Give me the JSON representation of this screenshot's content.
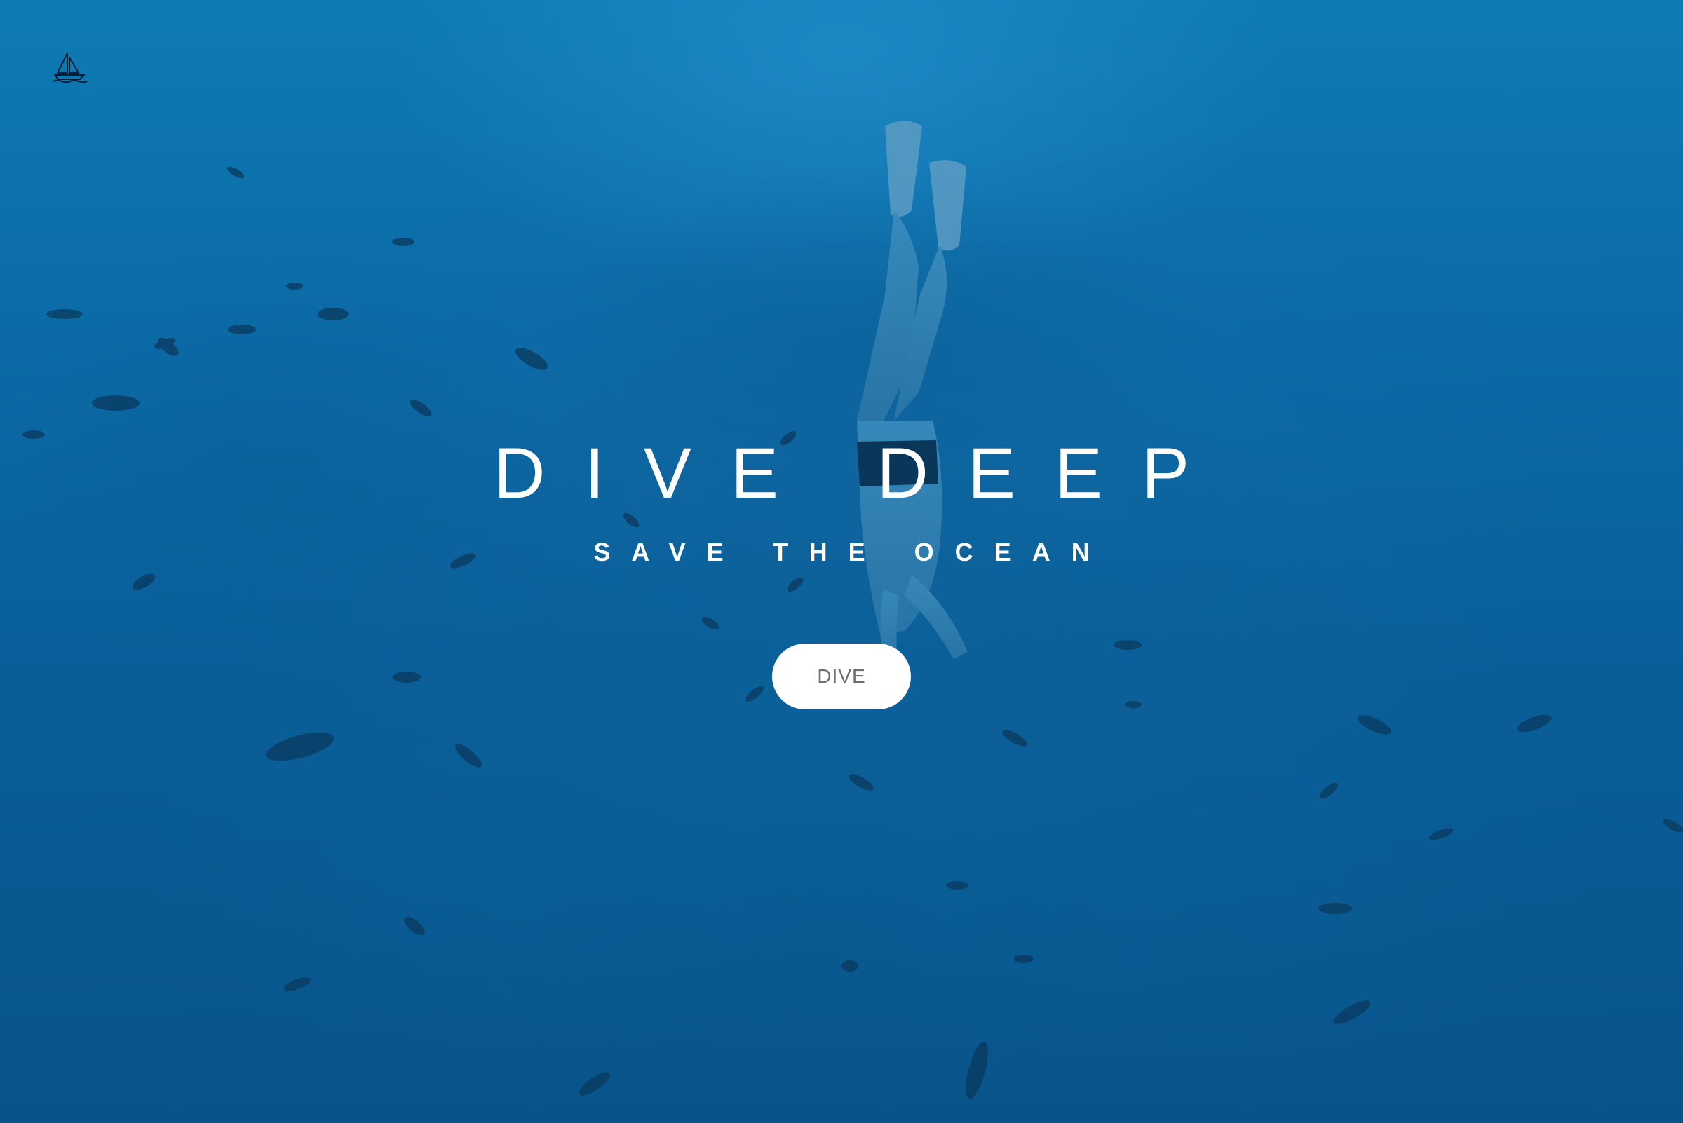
{
  "page": {
    "background_top": "#0e7bb4",
    "background_bottom": "#08548a"
  },
  "header": {
    "logo_icon": "sailboat-icon",
    "logo_color": "#0b1e33"
  },
  "hero": {
    "title": "DIVE DEEP",
    "subtitle": "SAVE THE OCEAN",
    "cta_label": "DIVE",
    "text_color": "#ffffff",
    "cta_text_color": "#6f6f6f"
  },
  "background_image": {
    "subject": "freediver"
  }
}
